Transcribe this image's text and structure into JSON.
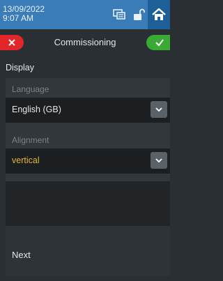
{
  "status_bar": {
    "date": "13/09/2022",
    "time": "9:07 AM",
    "icons": [
      "monitor-icon",
      "unlock-icon",
      "home-icon"
    ]
  },
  "header": {
    "title": "Commissioning",
    "cancel_icon": "close-icon",
    "confirm_icon": "check-icon"
  },
  "section": {
    "title": "Display"
  },
  "fields": {
    "language": {
      "label": "Language",
      "value": "English (GB)"
    },
    "alignment": {
      "label": "Alignment",
      "value": "vertical"
    }
  },
  "footer": {
    "next_label": "Next"
  },
  "colors": {
    "status_bar": "#3a7cb8",
    "home_button": "#1f5f98",
    "cancel": "#e3262a",
    "confirm": "#3aaa35",
    "accent_value": "#e0b43a"
  }
}
